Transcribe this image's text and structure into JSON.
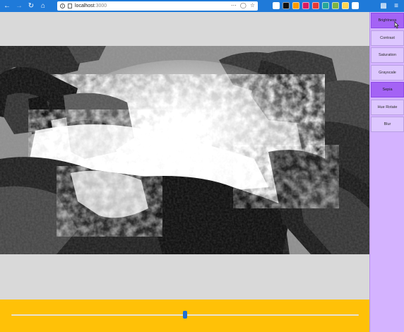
{
  "browser": {
    "url_host": "localhost",
    "url_port": ":3000",
    "extension_colors": [
      "#ffffff",
      "#111111",
      "#ff9a00",
      "#d81b60",
      "#e53935",
      "#26a69a",
      "#7cb342",
      "#ffd54f",
      "#ffffff"
    ]
  },
  "sidebar": {
    "buttons": [
      {
        "label": "Brightness",
        "selected": true
      },
      {
        "label": "Contrast",
        "selected": false
      },
      {
        "label": "Saturation",
        "selected": false
      },
      {
        "label": "Grayscale",
        "selected": false
      },
      {
        "label": "Sepia",
        "selected": true
      },
      {
        "label": "Hue Rotate",
        "selected": false
      },
      {
        "label": "Blur",
        "selected": false
      }
    ]
  },
  "image": {
    "subject": "waterfall-over-rocks",
    "filter": "grayscale"
  },
  "slider": {
    "value_fraction": 0.5,
    "track_color": "#e8e2d2",
    "thumb_color": "#1f6fd1",
    "bar_color": "#ffc107"
  },
  "colors": {
    "sidebar_bg": "#d4b3ff",
    "button_bg": "#ddc7ff",
    "button_selected_bg": "#a463f5",
    "stage_bg": "#d9d9d9",
    "browser_toolbar": "#1f7ad9"
  }
}
